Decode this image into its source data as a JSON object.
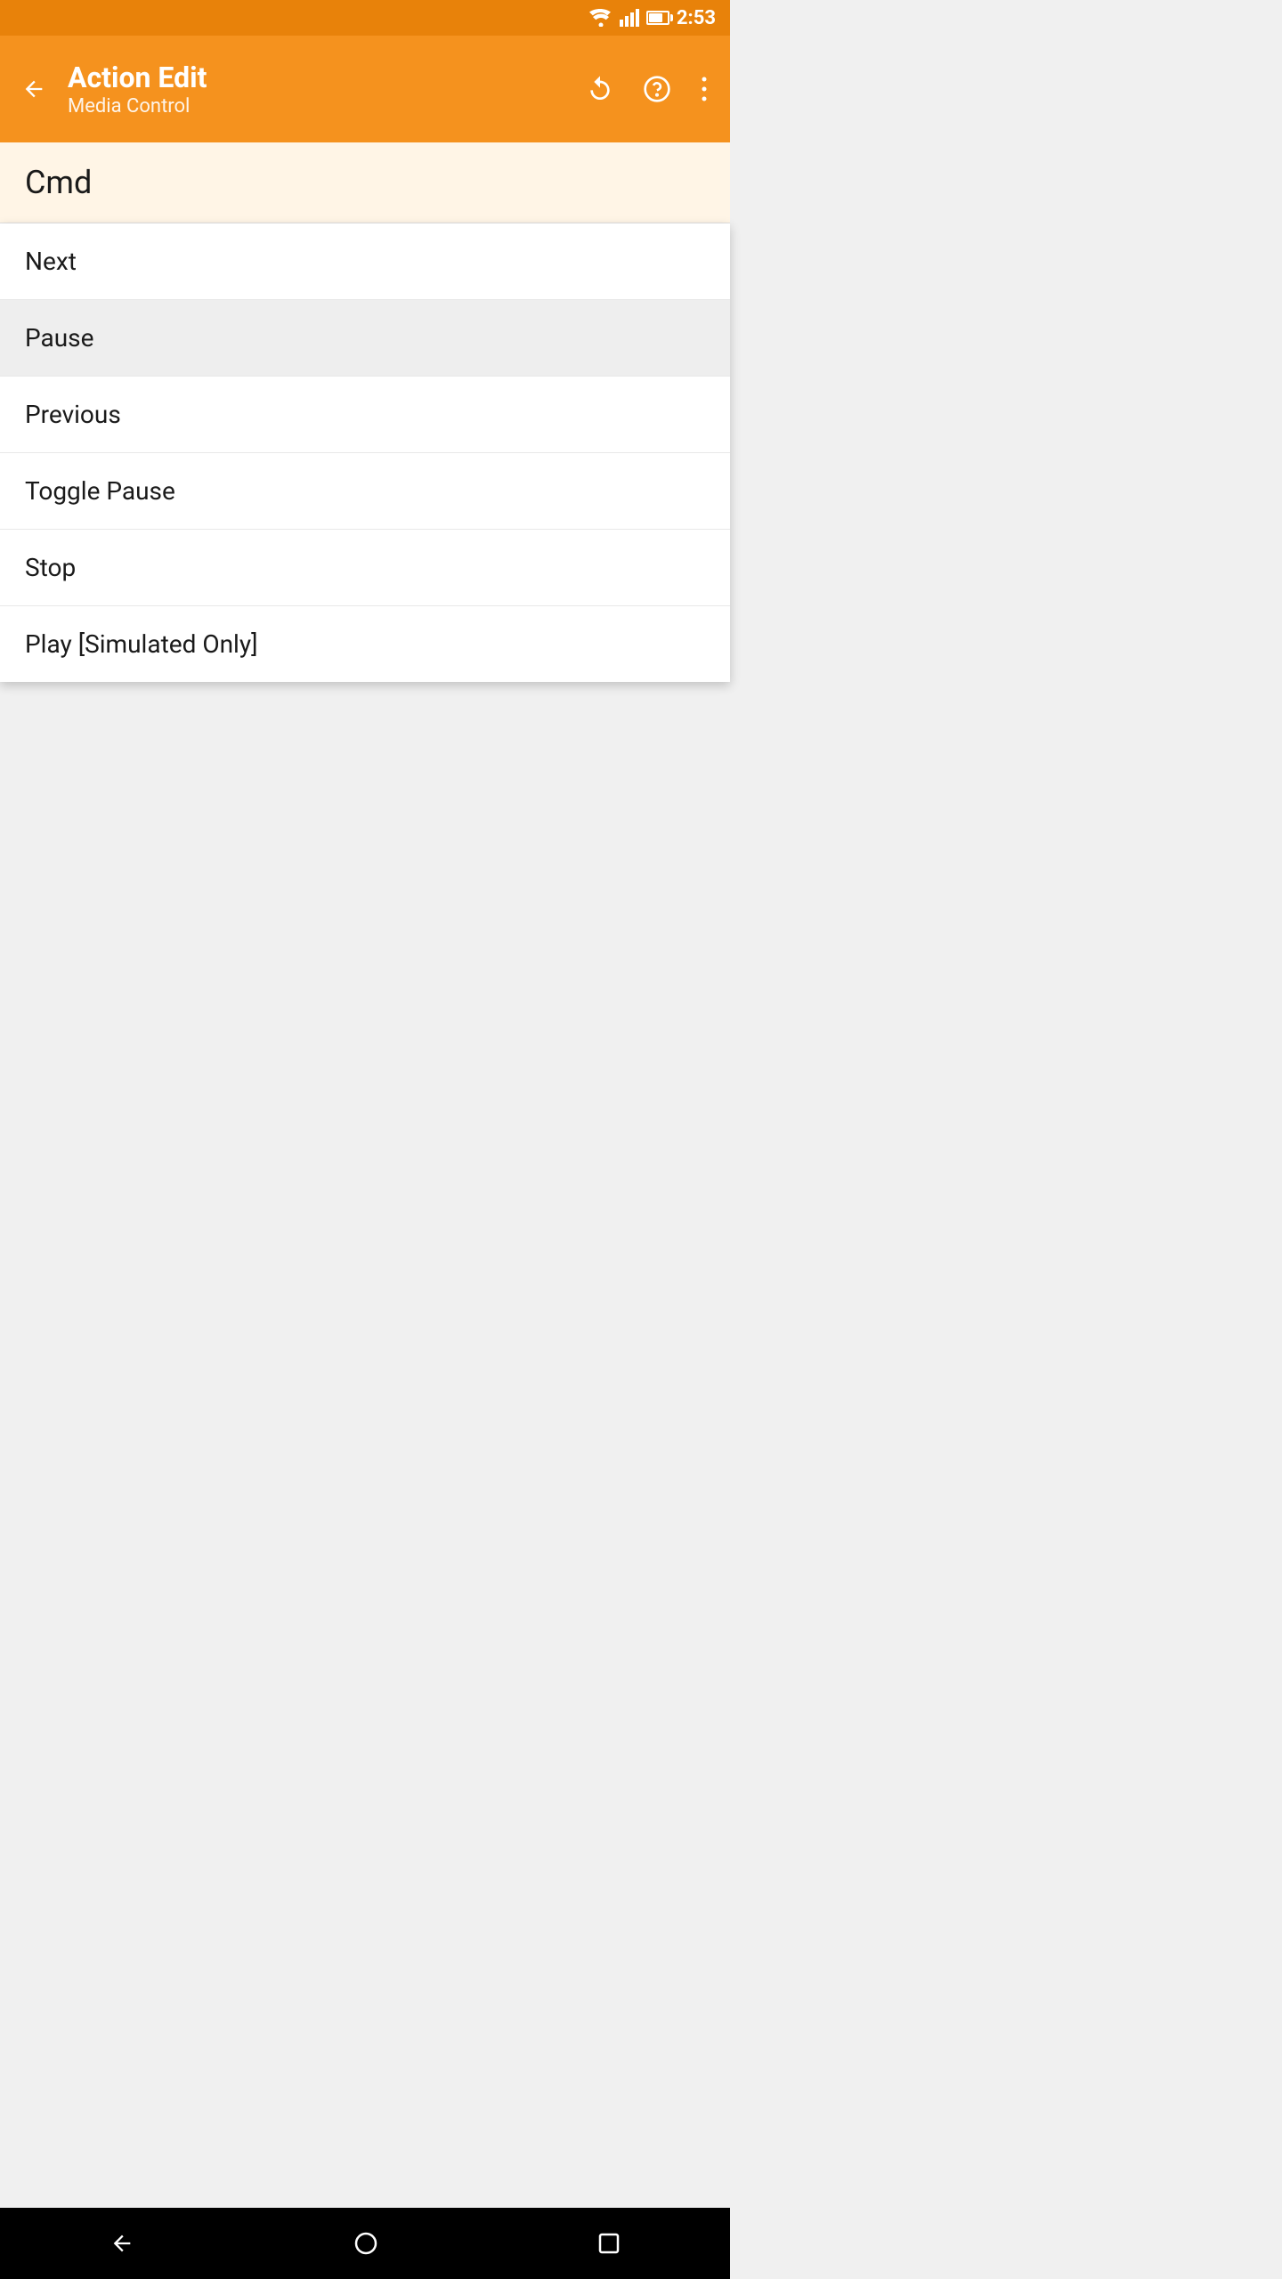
{
  "statusBar": {
    "time": "2:53",
    "wifiIcon": "wifi-icon",
    "signalIcon": "signal-icon",
    "batteryIcon": "battery-icon"
  },
  "appBar": {
    "title": "Action Edit",
    "subtitle": "Media Control",
    "backLabel": "←",
    "resetLabel": "↺",
    "helpLabel": "?",
    "moreLabel": "⋮"
  },
  "cmdLabel": "Cmd",
  "dropdownItems": [
    {
      "id": 1,
      "label": "Next",
      "selected": false
    },
    {
      "id": 2,
      "label": "Pause",
      "selected": true
    },
    {
      "id": 3,
      "label": "Previous",
      "selected": false
    },
    {
      "id": 4,
      "label": "Toggle Pause",
      "selected": false
    },
    {
      "id": 5,
      "label": "Stop",
      "selected": false
    },
    {
      "id": 6,
      "label": "Play [Simulated Only]",
      "selected": false
    }
  ],
  "navBar": {
    "backLabel": "◀",
    "homeLabel": "○",
    "recentLabel": "□"
  }
}
